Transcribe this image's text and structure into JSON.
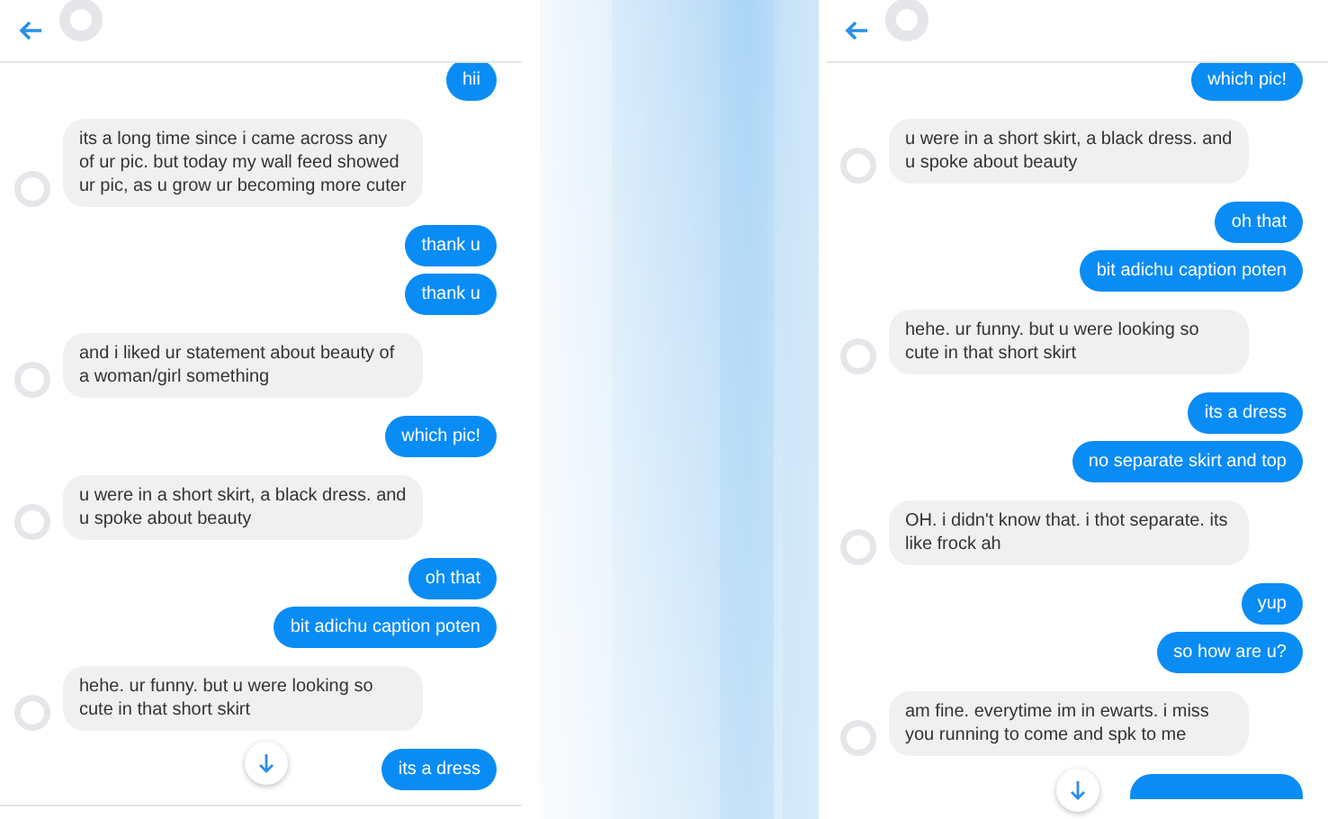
{
  "panels": [
    {
      "messages": [
        {
          "kind": "sent",
          "text": "hii"
        },
        {
          "kind": "received",
          "text": "its a long time since i came across any of ur pic. but today my wall feed showed ur pic, as u grow ur becoming more cuter"
        },
        {
          "kind": "sent",
          "text": "thank u"
        },
        {
          "kind": "sent",
          "text": "thank u"
        },
        {
          "kind": "received",
          "text": "and i liked ur statement about beauty of a woman/girl something"
        },
        {
          "kind": "sent",
          "text": "which pic!"
        },
        {
          "kind": "received",
          "text": "u were in a short skirt, a black dress. and u spoke about beauty"
        },
        {
          "kind": "sent",
          "text": "oh that"
        },
        {
          "kind": "sent",
          "text": "bit adichu caption poten"
        },
        {
          "kind": "received",
          "text": "hehe. ur funny. but u were looking so cute in that short skirt"
        },
        {
          "kind": "sent",
          "text": "its a dress"
        }
      ]
    },
    {
      "messages": [
        {
          "kind": "sent",
          "text": "which pic!"
        },
        {
          "kind": "received",
          "text": "u were in a short skirt, a black dress. and u spoke about beauty"
        },
        {
          "kind": "sent",
          "text": "oh that"
        },
        {
          "kind": "sent",
          "text": "bit adichu caption poten"
        },
        {
          "kind": "received",
          "text": "hehe. ur funny. but u were looking so cute in that short skirt"
        },
        {
          "kind": "sent",
          "text": "its a dress"
        },
        {
          "kind": "sent",
          "text": "no separate skirt and top"
        },
        {
          "kind": "received",
          "text": "OH. i didn't know that. i thot separate. its like frock ah"
        },
        {
          "kind": "sent",
          "text": "yup"
        },
        {
          "kind": "sent",
          "text": "so how are u?"
        },
        {
          "kind": "received",
          "text": "am fine. everytime im in ewarts. i miss you running to come and spk to me"
        },
        {
          "kind": "sent_partial"
        }
      ]
    }
  ]
}
